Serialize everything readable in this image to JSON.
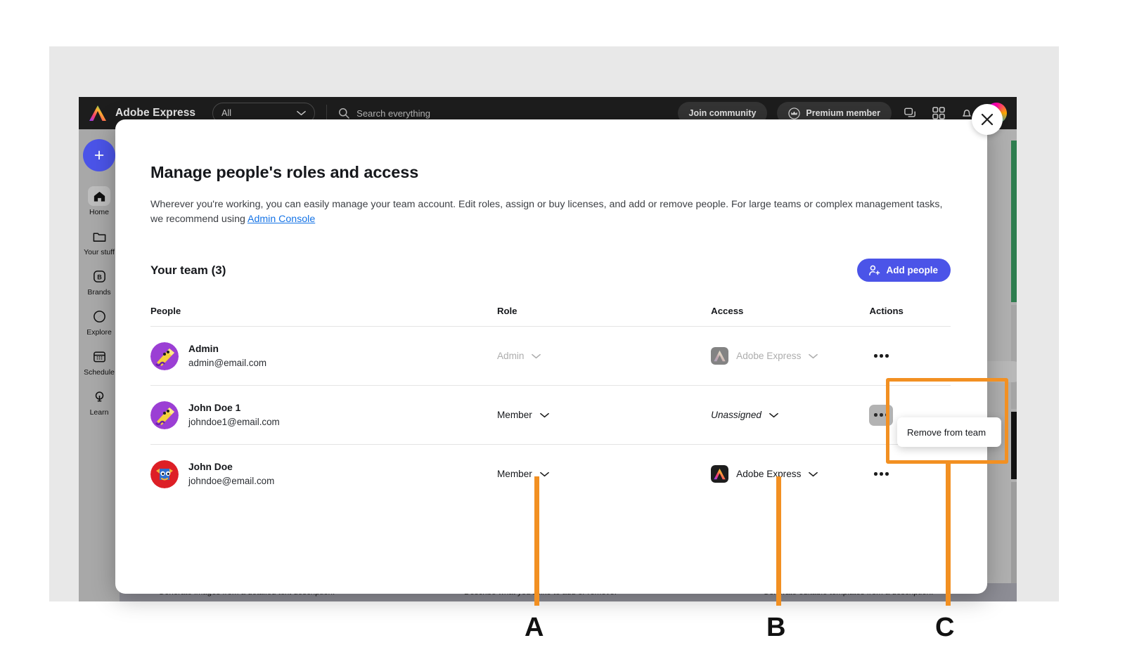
{
  "app": {
    "brand": "Adobe Express",
    "filter_label": "All",
    "search_placeholder": "Search everything",
    "join_community": "Join community",
    "premium_member": "Premium member"
  },
  "sidebar": {
    "create_label": "+",
    "items": [
      {
        "label": "Home",
        "icon": "home-icon"
      },
      {
        "label": "Your stuff",
        "icon": "folder-icon"
      },
      {
        "label": "Brands",
        "icon": "brands-icon"
      },
      {
        "label": "Explore",
        "icon": "compass-icon"
      },
      {
        "label": "Schedule",
        "icon": "calendar-icon"
      },
      {
        "label": "Learn",
        "icon": "lightbulb-icon"
      }
    ]
  },
  "background_captions": [
    "Generate images from a detailed text description.",
    "Describe what you'd like to add or remove.",
    "Generate editable templates from a description."
  ],
  "modal": {
    "title": "Manage people's roles and access",
    "description_before": "Wherever you're working, you can easily manage your team account. Edit roles, assign or buy licenses, and add or remove people. For large teams or complex management tasks, we recommend using ",
    "description_link": "Admin Console",
    "team_heading": "Your team (3)",
    "add_people_label": "Add people",
    "columns": {
      "people": "People",
      "role": "Role",
      "access": "Access",
      "actions": "Actions"
    },
    "rows": [
      {
        "name": "Admin",
        "email": "admin@email.com",
        "avatar": "purple-pencil-avatar",
        "role": "Admin",
        "role_disabled": true,
        "access": "Adobe Express",
        "access_disabled": true,
        "access_icon": "adobe-express-icon",
        "actions_icon": "more-actions-icon",
        "actions_active": false
      },
      {
        "name": "John Doe 1",
        "email": "johndoe1@email.com",
        "avatar": "purple-pencil-avatar",
        "role": "Member",
        "role_disabled": false,
        "access": "Unassigned",
        "access_disabled": false,
        "access_icon": "none",
        "actions_icon": "more-actions-icon",
        "actions_active": true
      },
      {
        "name": "John Doe",
        "email": "johndoe@email.com",
        "avatar": "red-blue-monster-avatar",
        "role": "Member",
        "role_disabled": false,
        "access": "Adobe Express",
        "access_disabled": false,
        "access_icon": "adobe-express-icon",
        "actions_icon": "more-actions-icon",
        "actions_active": false
      }
    ],
    "popover_item": "Remove from team",
    "close_label": "×"
  },
  "annotations": {
    "labels": [
      "A",
      "B",
      "C"
    ],
    "color": "#f29022"
  }
}
